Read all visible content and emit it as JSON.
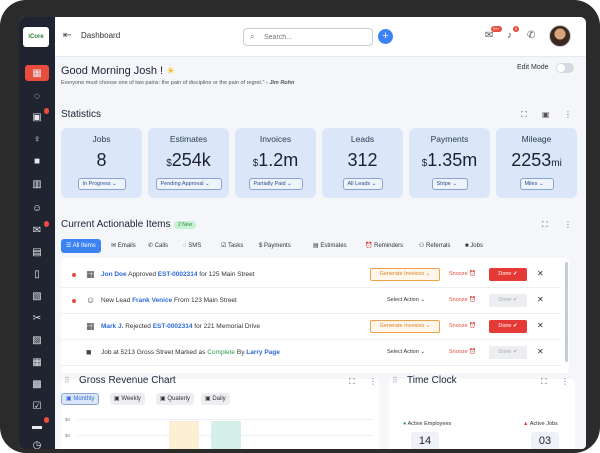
{
  "brand": {
    "logo_text": "iCore"
  },
  "header": {
    "title": "Dashboard",
    "search_placeholder": "Search...",
    "notifications": {
      "messages_badge": "99+",
      "bell_badge": "9"
    }
  },
  "greeting": {
    "title": "Good Morning Josh !",
    "quote": "Everyone must choose one of two pains: the pain of discipline or the pain of regret.\"",
    "author": "- Jim Rohn",
    "edit_mode_label": "Edit Mode"
  },
  "statistics": {
    "title": "Statistics",
    "cards": [
      {
        "label": "Jobs",
        "prefix": "",
        "value": "8",
        "unit": "",
        "dropdown": "In Progress"
      },
      {
        "label": "Estimates",
        "prefix": "$",
        "value": "254k",
        "unit": "",
        "dropdown": "Pending Approval"
      },
      {
        "label": "Invoices",
        "prefix": "$",
        "value": "1.2m",
        "unit": "",
        "dropdown": "Partially Paid"
      },
      {
        "label": "Leads",
        "prefix": "",
        "value": "312",
        "unit": "",
        "dropdown": "All Leads"
      },
      {
        "label": "Payments",
        "prefix": "$",
        "value": "1.35m",
        "unit": "",
        "dropdown": "Stripe"
      },
      {
        "label": "Mileage",
        "prefix": "",
        "value": "2253",
        "unit": "mi",
        "dropdown": "Miles"
      }
    ]
  },
  "actionable": {
    "title": "Current Actionable Items",
    "new_badge": "2 New",
    "filters": [
      "All Items",
      "Emails",
      "Calls",
      "SMS",
      "Tasks",
      "Payments",
      "Estimates",
      "Reminders",
      "Referrals",
      "Jobs"
    ],
    "rows": [
      {
        "unread": true,
        "parts": [
          {
            "text": "Jon Doe",
            "style": "link"
          },
          {
            "text": " Approved ",
            "style": ""
          },
          {
            "text": "EST-0002314",
            "style": "link"
          },
          {
            "text": " for 125 Main Street",
            "style": ""
          }
        ],
        "action": "Generate Invoices",
        "action_type": "button",
        "snooze": "Snooze",
        "done": "Done",
        "done_enabled": true
      },
      {
        "unread": true,
        "parts": [
          {
            "text": "New Lead ",
            "style": ""
          },
          {
            "text": "Frank Venice",
            "style": "link"
          },
          {
            "text": " From 123 Main Street",
            "style": ""
          }
        ],
        "action": "Select Action",
        "action_type": "select",
        "snooze": "Snooze",
        "done": "Done",
        "done_enabled": false
      },
      {
        "unread": false,
        "parts": [
          {
            "text": "Mark J.",
            "style": "link"
          },
          {
            "text": " Rejected ",
            "style": ""
          },
          {
            "text": "EST-0002314",
            "style": "link"
          },
          {
            "text": " for 221 Memorial Drive",
            "style": ""
          }
        ],
        "action": "Generate Invoices",
        "action_type": "button",
        "snooze": "Snooze",
        "done": "Done",
        "done_enabled": true
      },
      {
        "unread": false,
        "parts": [
          {
            "text": "Job at 5213 Gross Street Marked as ",
            "style": ""
          },
          {
            "text": "Complete",
            "style": "ok"
          },
          {
            "text": " By ",
            "style": ""
          },
          {
            "text": "Larry Page",
            "style": "link"
          }
        ],
        "action": "Select Action",
        "action_type": "select",
        "snooze": "Snooze",
        "done": "Done",
        "done_enabled": false
      }
    ]
  },
  "revenue_chart": {
    "title": "Gross Revenue Chart",
    "periods": [
      "Monthly",
      "Weekly",
      "Quaterly",
      "Daily"
    ],
    "active_period": "Monthly",
    "y_ticks": [
      "$0",
      "$0"
    ]
  },
  "time_clock": {
    "title": "Time Clock",
    "active_employees_label": "Active Employees",
    "active_employees": "14",
    "active_jobs_label": "Active Jobs",
    "active_jobs": "03"
  },
  "colors": {
    "accent": "#3b82f6",
    "danger": "#e53935",
    "warning": "#f0a24a",
    "sidebar": "#1f2430",
    "card": "#dbe7f8"
  }
}
